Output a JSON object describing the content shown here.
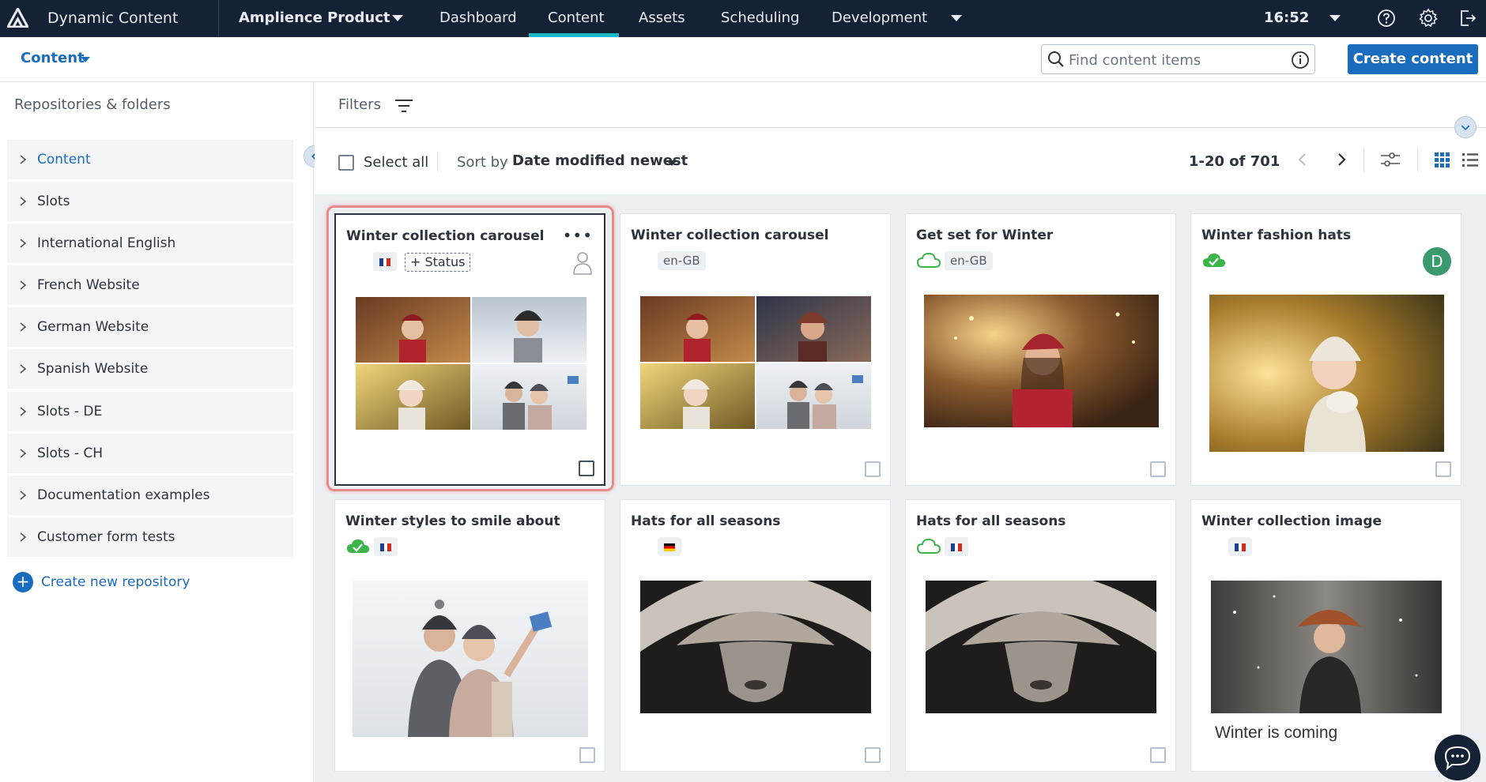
{
  "topbar": {
    "app_title": "Dynamic Content",
    "hub_name": "Amplience Product",
    "nav": [
      "Dashboard",
      "Content",
      "Assets",
      "Scheduling",
      "Development"
    ],
    "active_nav": "Content",
    "time": "16:52"
  },
  "subbar": {
    "section": "Content",
    "search_placeholder": "Find content items",
    "create_button": "Create content"
  },
  "sidebar": {
    "title": "Repositories & folders",
    "items": [
      {
        "label": "Content",
        "active": true
      },
      {
        "label": "Slots"
      },
      {
        "label": "International English"
      },
      {
        "label": "French Website"
      },
      {
        "label": "German Website"
      },
      {
        "label": "Spanish Website"
      },
      {
        "label": "Slots - DE"
      },
      {
        "label": "Slots - CH"
      },
      {
        "label": "Documentation examples"
      },
      {
        "label": "Customer form tests"
      }
    ],
    "create_label": "Create new repository"
  },
  "main": {
    "filters_label": "Filters",
    "select_all": "Select all",
    "sort_label": "Sort by",
    "sort_value": "Date modified newest",
    "pager": "1-20 of 701"
  },
  "cards": [
    {
      "title": "Winter collection carousel",
      "locale": "fr",
      "status": "+ Status",
      "selected": true
    },
    {
      "title": "Winter collection carousel",
      "locale_text": "en-GB"
    },
    {
      "title": "Get set for Winter",
      "locale_text": "en-GB",
      "cloud": "outline"
    },
    {
      "title": "Winter fashion hats",
      "cloud": "filled",
      "avatar": "D"
    },
    {
      "title": "Winter styles to smile about",
      "cloud": "filled",
      "locale": "fr"
    },
    {
      "title": "Hats for all seasons",
      "locale": "de"
    },
    {
      "title": "Hats for all seasons",
      "cloud": "outline",
      "locale": "fr"
    },
    {
      "title": "Winter collection image",
      "locale": "fr",
      "caption": "Winter is coming"
    }
  ],
  "colors": {
    "topbar": "#152236",
    "accent": "#1a6cbf",
    "nav_underline": "#1db8c7",
    "published_green": "#3bb54a",
    "highlight": "#e88a8a"
  }
}
